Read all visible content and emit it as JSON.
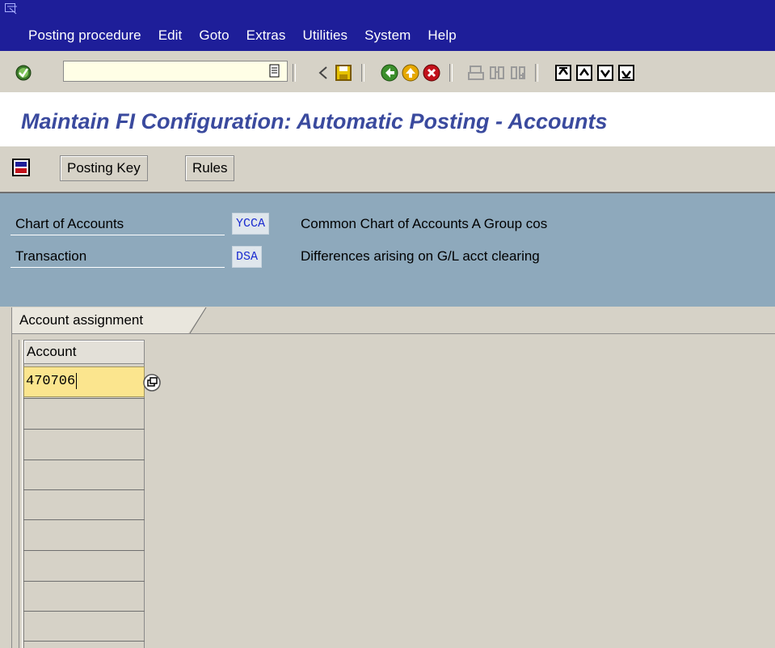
{
  "menu": {
    "items": [
      {
        "label": "Posting procedure"
      },
      {
        "label": "Edit"
      },
      {
        "label": "Goto"
      },
      {
        "label": "Extras"
      },
      {
        "label": "Utilities"
      },
      {
        "label": "System"
      },
      {
        "label": "Help"
      }
    ]
  },
  "toolbar": {
    "command_value": "",
    "icons": [
      "enter-icon",
      "command-dropdown-icon",
      "back-arrow-icon",
      "save-icon",
      "back-icon",
      "exit-icon",
      "cancel-icon",
      "print-icon",
      "find-icon",
      "find-next-icon",
      "first-page-icon",
      "previous-page-icon",
      "next-page-icon",
      "last-page-icon"
    ]
  },
  "title": "Maintain FI Configuration: Automatic Posting - Accounts",
  "app_toolbar": {
    "icon": "display-change-icon",
    "posting_key_label": "Posting Key",
    "rules_label": "Rules"
  },
  "header": {
    "chart_label": "Chart of Accounts",
    "chart_code": "YCCA",
    "chart_desc": "Common Chart of Accounts A Group cos",
    "transaction_label": "Transaction",
    "transaction_code": "DSA",
    "transaction_desc": "Differences arising on G/L acct clearing"
  },
  "tab": {
    "label": "Account assignment"
  },
  "table": {
    "column_header": "Account",
    "rows": [
      {
        "account": "470706"
      },
      {
        "account": ""
      },
      {
        "account": ""
      },
      {
        "account": ""
      },
      {
        "account": ""
      },
      {
        "account": ""
      },
      {
        "account": ""
      },
      {
        "account": ""
      },
      {
        "account": ""
      }
    ]
  },
  "colors": {
    "menubar": "#1e1e99",
    "title": "#3a4a9e",
    "header_bg": "#8ea9bc",
    "input_active": "#fbe58e"
  }
}
